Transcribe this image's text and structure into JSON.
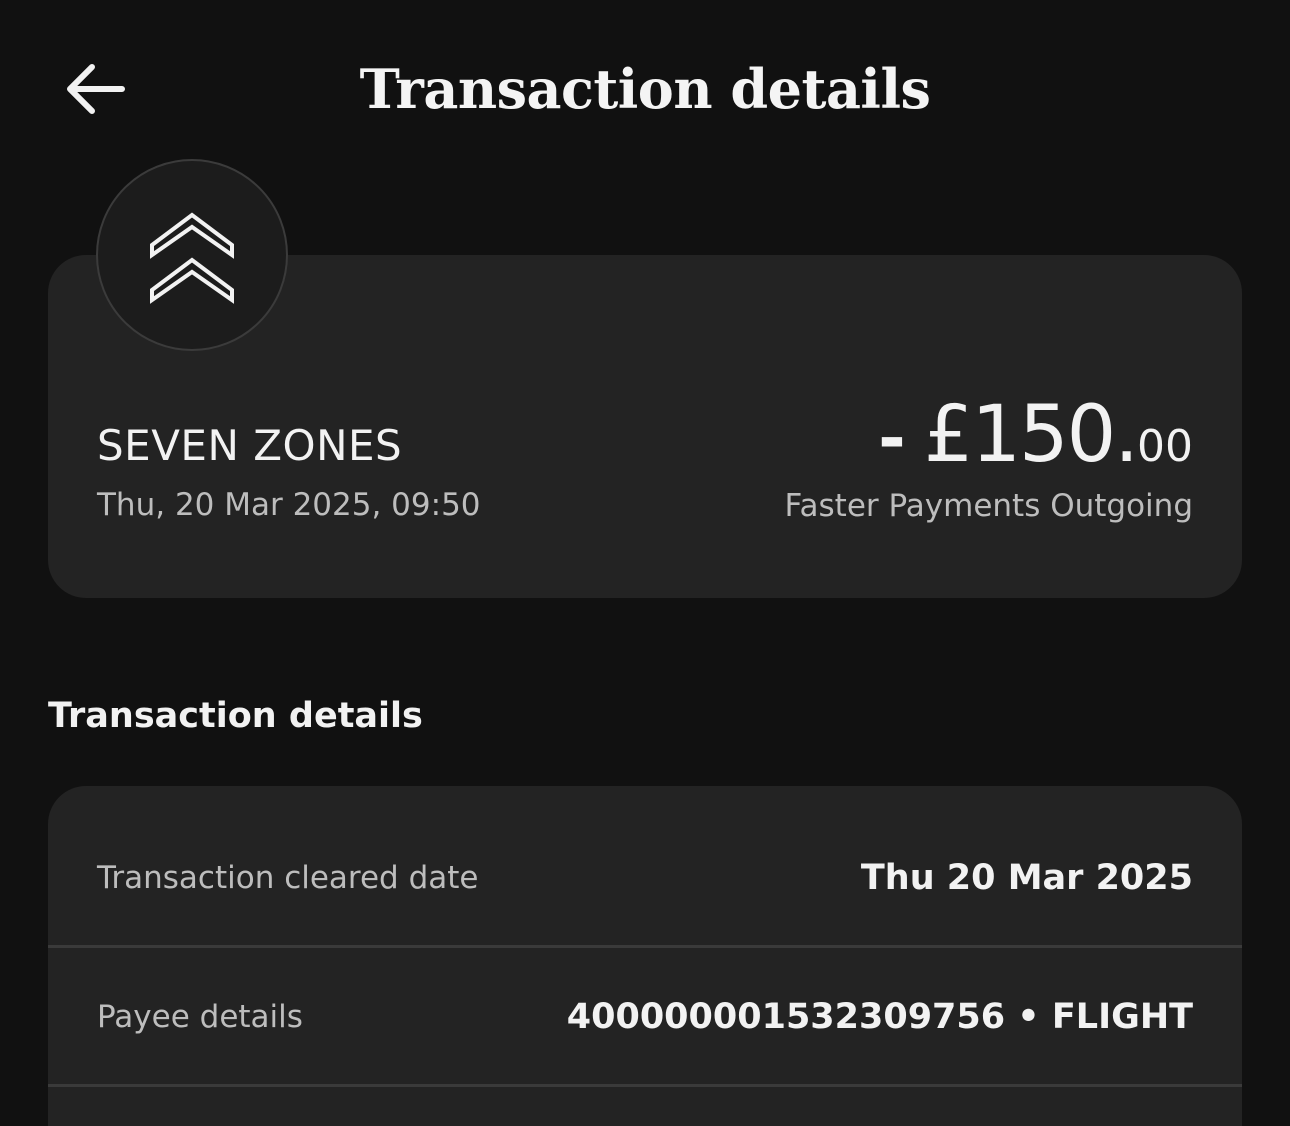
{
  "header": {
    "title": "Transaction details",
    "back_icon": "arrow-left-icon"
  },
  "summary": {
    "logo_icon": "double-chevron-up-icon",
    "merchant_name": "SEVEN ZONES",
    "datetime": "Thu, 20 Mar 2025, 09:50",
    "amount_sign": "-",
    "amount_main": "£150.",
    "amount_decimal": "00",
    "payment_type": "Faster Payments Outgoing"
  },
  "details": {
    "heading": "Transaction details",
    "rows": [
      {
        "label": "Transaction cleared date",
        "value": "Thu 20 Mar 2025"
      },
      {
        "label": "Payee details",
        "value": "400000001532309756 • FLIGHT"
      }
    ]
  },
  "colors": {
    "background": "#111111",
    "card": "#232323",
    "text_primary": "#f2f2f2",
    "text_secondary": "#bdbdbd",
    "divider": "#3a3a3a"
  }
}
